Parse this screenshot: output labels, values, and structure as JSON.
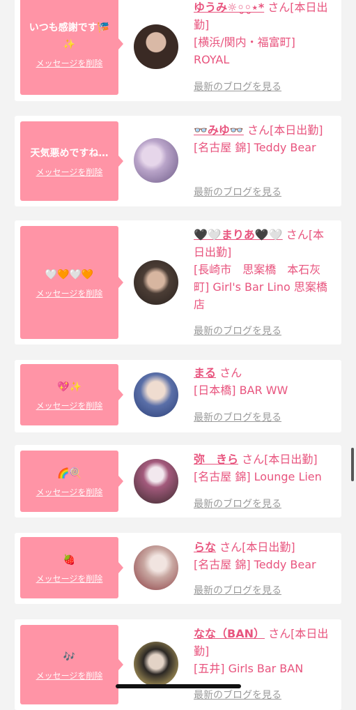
{
  "common": {
    "delete_label": "メッセージを削除",
    "blog_label": "最新のブログを見る",
    "san": "さん"
  },
  "cards": [
    {
      "message": "いつも感謝です🎏\n✨",
      "name": "ゆうみ☼︎◦̮◦̮⋆*",
      "status": "[本日出勤]",
      "shop": "[横浜/関内・福富町] ROYAL",
      "avatar_color": "#3a2a24"
    },
    {
      "message": "天気悪めですね…",
      "name": "👓みゆ👓",
      "status": "[本日出勤]",
      "shop": "[名古屋 錦] Teddy Bear",
      "avatar_color": "#b9a4c9"
    },
    {
      "message": "🤍🧡🤍🧡",
      "name": "🖤🤍まりあ🖤🤍",
      "status": "[本日出勤]",
      "shop": "[長崎市　思案橋　本石灰町] Girl's Bar Lino 思案橋店",
      "avatar_color": "#4b3d35"
    },
    {
      "message": "💖✨",
      "name": "まる",
      "status": "",
      "shop": "[日本橋] BAR WW",
      "avatar_color": "#5a6fa8"
    },
    {
      "message": "🌈🍭",
      "name": "弥　きら",
      "status": "[本日出勤]",
      "shop": "[名古屋 錦] Lounge Lien",
      "avatar_color": "#3c2a2e"
    },
    {
      "message": "🍓",
      "name": "らな",
      "status": "[本日出勤]",
      "shop": "[名古屋 錦] Teddy Bear",
      "avatar_color": "#c8a7a1"
    },
    {
      "message": "🎶",
      "name": "なな（BAN）",
      "status": "[本日出勤]",
      "shop": "[五井] Girls Bar BAN",
      "avatar_color": "#2b2724"
    }
  ]
}
